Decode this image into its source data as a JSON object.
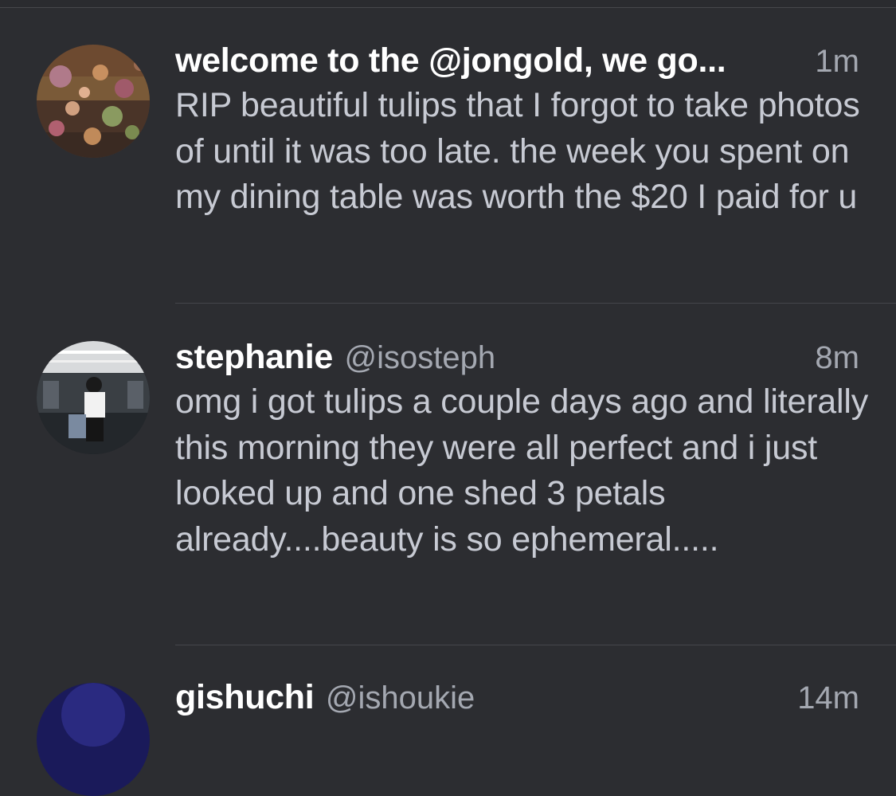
{
  "tweets": [
    {
      "display_name": "welcome to the @jongold, we go...",
      "handle": "",
      "time": "1m",
      "text": "RIP beautiful tulips that I forgot to take photos of until it was too late. the week you spent on my dining table was worth the $20 I paid for u"
    },
    {
      "display_name": "stephanie",
      "handle": "@isosteph",
      "time": "8m",
      "text": "omg i got tulips a couple days ago and literally this morning they were all perfect and i just looked up and one shed 3 petals already....beauty is so ephemeral....."
    },
    {
      "display_name": "gishuchi",
      "handle": "@ishoukie",
      "time": "14m",
      "text": ""
    }
  ],
  "colors": {
    "background": "#2c2d31",
    "name": "#ffffff",
    "secondary": "#a4a8b1",
    "body": "#c7cad3",
    "separator": "#45464b"
  }
}
